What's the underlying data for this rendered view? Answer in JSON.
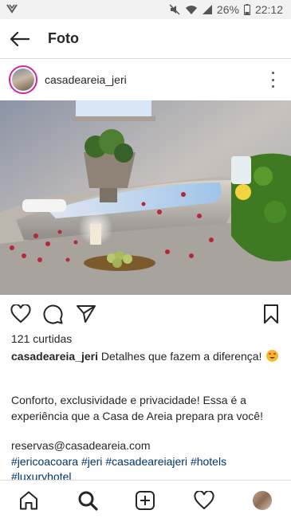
{
  "status_bar": {
    "battery": "26%",
    "time": "22:12"
  },
  "header": {
    "title": "Foto"
  },
  "post": {
    "username": "casadeareia_jeri",
    "likes": "121 curtidas",
    "caption_username": "casadeareia_jeri",
    "caption_text": "Detalhes que fazem a diferença!",
    "body_text": "Conforto, exclusividade e privacidade! Essa é a experiência que a Casa de Areia prepara pra você!",
    "email": "reservas@casadeareia.com",
    "hashtags": [
      "#jericoacoara",
      "#jeri",
      "#casadeareiajeri",
      "#hotels",
      "#luxuryhotel"
    ]
  },
  "icons": {
    "back": "arrow-left-icon",
    "more": "more-vertical-icon",
    "like": "heart-icon",
    "comment": "comment-icon",
    "share": "send-icon",
    "save": "bookmark-icon",
    "home": "home-icon",
    "search": "search-icon",
    "new_post": "add-post-icon",
    "activity": "heart-icon",
    "profile": "profile-avatar"
  },
  "colors": {
    "text": "#262626",
    "hashtag": "#003569",
    "divider": "#dbdbdb",
    "story_ring": "#d6249f"
  }
}
